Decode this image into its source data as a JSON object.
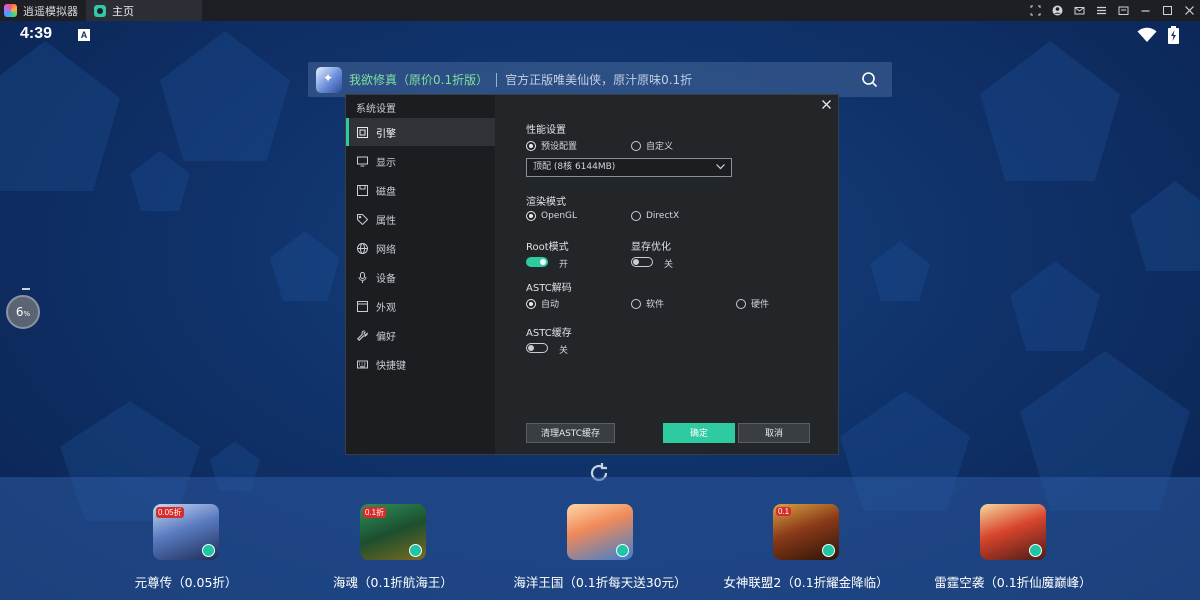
{
  "titlebar": {
    "app_name": "逍遥模拟器",
    "tab_label": "主页",
    "controls": [
      "screenshot-icon",
      "account-icon",
      "mail-icon",
      "menu-icon",
      "restore-icon",
      "minimize-icon",
      "maximize-icon",
      "close-icon"
    ]
  },
  "status_bar": {
    "time": "4:39",
    "notification_letter": "A"
  },
  "search": {
    "title": "我欲修真（原价0.1折版）",
    "subtitle": "官方正版唯美仙侠，原汁原味0.1折"
  },
  "float_ball": {
    "value": "6",
    "unit": "%"
  },
  "dialog": {
    "title": "系统设置",
    "sidebar": [
      {
        "label": "引擎",
        "icon": "engine-icon",
        "active": true
      },
      {
        "label": "显示",
        "icon": "monitor-icon",
        "active": false
      },
      {
        "label": "磁盘",
        "icon": "disk-icon",
        "active": false
      },
      {
        "label": "属性",
        "icon": "tag-icon",
        "active": false
      },
      {
        "label": "网络",
        "icon": "globe-icon",
        "active": false
      },
      {
        "label": "设备",
        "icon": "microphone-icon",
        "active": false
      },
      {
        "label": "外观",
        "icon": "window-icon",
        "active": false
      },
      {
        "label": "偏好",
        "icon": "wrench-icon",
        "active": false
      },
      {
        "label": "快捷键",
        "icon": "keyboard-icon",
        "active": false
      }
    ],
    "performance": {
      "label": "性能设置",
      "preset": "预设配置",
      "custom": "自定义",
      "selected": "预设配置",
      "dropdown_value": "顶配 (8核 6144MB)"
    },
    "render": {
      "label": "渲染模式",
      "opengl": "OpenGL",
      "directx": "DirectX",
      "selected": "OpenGL"
    },
    "root": {
      "label": "Root模式",
      "state_text": "开",
      "enabled": true
    },
    "vram": {
      "label": "显存优化",
      "state_text": "关",
      "enabled": false
    },
    "astc_decode": {
      "label": "ASTC解码",
      "auto": "自动",
      "software": "软件",
      "hardware": "硬件",
      "selected": "自动"
    },
    "astc_cache": {
      "label": "ASTC缓存",
      "state_text": "关",
      "enabled": false
    },
    "buttons": {
      "clear_cache": "清理ASTC缓存",
      "confirm": "确定",
      "cancel": "取消"
    }
  },
  "dock": [
    {
      "label": "元尊传（0.05折）",
      "tag": "0.05折"
    },
    {
      "label": "海魂（0.1折航海王）",
      "tag": "0.1折"
    },
    {
      "label": "海洋王国（0.1折每天送30元）",
      "tag": ""
    },
    {
      "label": "女神联盟2（0.1折耀金降临）",
      "tag": "0.1"
    },
    {
      "label": "雷霆空袭（0.1折仙魔巅峰）",
      "tag": ""
    }
  ]
}
